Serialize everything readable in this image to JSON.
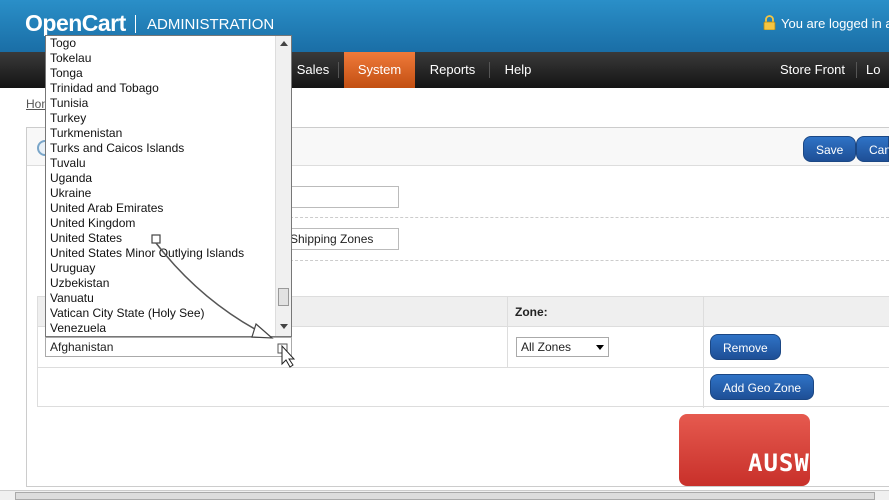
{
  "header": {
    "logo": "OpenCart",
    "admin_title": "ADMINISTRATION",
    "logged_in": "You are logged in as"
  },
  "nav": {
    "items": [
      "Sales",
      "System",
      "Reports",
      "Help"
    ],
    "active": "System",
    "store_front": "Store Front",
    "logout": "Lo"
  },
  "breadcrumb": "Hon",
  "buttons": {
    "save": "Save",
    "cancel": "Can"
  },
  "form": {
    "description_value": "Shipping Zones"
  },
  "table": {
    "zone_header": "Zone:",
    "country_value": "Afghanistan",
    "zone_value": "All Zones",
    "remove": "Remove",
    "add_geo_zone": "Add Geo Zone"
  },
  "dropdown_options": [
    "Togo",
    "Tokelau",
    "Tonga",
    "Trinidad and Tobago",
    "Tunisia",
    "Turkey",
    "Turkmenistan",
    "Turks and Caicos Islands",
    "Tuvalu",
    "Uganda",
    "Ukraine",
    "United Arab Emirates",
    "United Kingdom",
    "United States",
    "United States Minor Outlying Islands",
    "Uruguay",
    "Uzbekistan",
    "Vanuatu",
    "Vatican City State (Holy See)",
    "Venezuela"
  ],
  "watermark": "AUSWEB",
  "colors": {
    "header": "#1f7bb6",
    "nav_active": "#d9631f",
    "button": "#2659a8",
    "watermark": "#d2413a"
  }
}
